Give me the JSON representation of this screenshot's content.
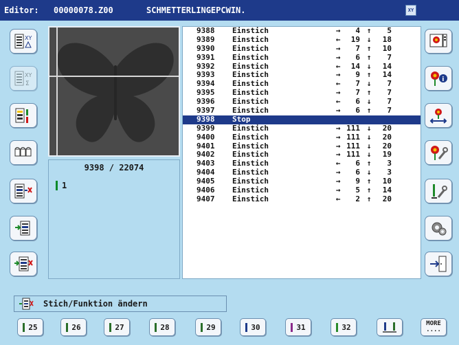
{
  "title": {
    "editor_label": "Editor:",
    "file_name": "00000078.Z00",
    "design_name": "SCHMETTERLINGEPCWIN."
  },
  "colors": {
    "titlebar": "#1e3a8a",
    "background": "#b4dcf0",
    "selection": "#1e3a8a",
    "needle_green": "#0a8a2a"
  },
  "left_toolbar": [
    "xy-delta-icon",
    "xy-sigma-icon",
    "color-change-icon",
    "chain-stitch-icon",
    "delete-stitch-icon",
    "insert-stitch-icon",
    "move-stitch-icon"
  ],
  "right_toolbar": [
    "design-view-icon",
    "flower-info-icon",
    "flower-move-icon",
    "flower-tool-icon",
    "needle-tool-icon",
    "gear-icon",
    "exit-door-icon"
  ],
  "stitch_counter": "9398 / 22074",
  "needle_indicator": "1",
  "stitches": [
    {
      "num": "9388",
      "fn": "Einstich",
      "dx_arrow": "→",
      "dx": "4",
      "dy_arrow": "↑",
      "dy": "5"
    },
    {
      "num": "9389",
      "fn": "Einstich",
      "dx_arrow": "←",
      "dx": "19",
      "dy_arrow": "↓",
      "dy": "18"
    },
    {
      "num": "9390",
      "fn": "Einstich",
      "dx_arrow": "→",
      "dx": "7",
      "dy_arrow": "↑",
      "dy": "10"
    },
    {
      "num": "9391",
      "fn": "Einstich",
      "dx_arrow": "→",
      "dx": "6",
      "dy_arrow": "↑",
      "dy": "7"
    },
    {
      "num": "9392",
      "fn": "Einstich",
      "dx_arrow": "←",
      "dx": "14",
      "dy_arrow": "↓",
      "dy": "14"
    },
    {
      "num": "9393",
      "fn": "Einstich",
      "dx_arrow": "→",
      "dx": "9",
      "dy_arrow": "↑",
      "dy": "14"
    },
    {
      "num": "9394",
      "fn": "Einstich",
      "dx_arrow": "←",
      "dx": "7",
      "dy_arrow": "↓",
      "dy": "7"
    },
    {
      "num": "9395",
      "fn": "Einstich",
      "dx_arrow": "→",
      "dx": "7",
      "dy_arrow": "↑",
      "dy": "7"
    },
    {
      "num": "9396",
      "fn": "Einstich",
      "dx_arrow": "←",
      "dx": "6",
      "dy_arrow": "↓",
      "dy": "7"
    },
    {
      "num": "9397",
      "fn": "Einstich",
      "dx_arrow": "→",
      "dx": "6",
      "dy_arrow": "↑",
      "dy": "7"
    },
    {
      "num": "9398",
      "fn": "Stop",
      "dx_arrow": "",
      "dx": "",
      "dy_arrow": "",
      "dy": "",
      "selected": true
    },
    {
      "num": "9399",
      "fn": "Einstich",
      "dx_arrow": "→",
      "dx": "111",
      "dy_arrow": "↓",
      "dy": "20"
    },
    {
      "num": "9400",
      "fn": "Einstich",
      "dx_arrow": "→",
      "dx": "111",
      "dy_arrow": "↓",
      "dy": "20"
    },
    {
      "num": "9401",
      "fn": "Einstich",
      "dx_arrow": "→",
      "dx": "111",
      "dy_arrow": "↓",
      "dy": "20"
    },
    {
      "num": "9402",
      "fn": "Einstich",
      "dx_arrow": "→",
      "dx": "111",
      "dy_arrow": "↓",
      "dy": "19"
    },
    {
      "num": "9403",
      "fn": "Einstich",
      "dx_arrow": "←",
      "dx": "6",
      "dy_arrow": "↑",
      "dy": "3"
    },
    {
      "num": "9404",
      "fn": "Einstich",
      "dx_arrow": "→",
      "dx": "6",
      "dy_arrow": "↓",
      "dy": "3"
    },
    {
      "num": "9405",
      "fn": "Einstich",
      "dx_arrow": "→",
      "dx": "9",
      "dy_arrow": "↑",
      "dy": "10"
    },
    {
      "num": "9406",
      "fn": "Einstich",
      "dx_arrow": "→",
      "dx": "5",
      "dy_arrow": "↑",
      "dy": "14"
    },
    {
      "num": "9407",
      "fn": "Einstich",
      "dx_arrow": "←",
      "dx": "2",
      "dy_arrow": "↑",
      "dy": "20"
    }
  ],
  "status_text": "Stich/Funktion ändern",
  "needle_buttons": [
    {
      "label": "25",
      "color": "#2a6e2a"
    },
    {
      "label": "26",
      "color": "#2a6e2a"
    },
    {
      "label": "27",
      "color": "#2a6e2a"
    },
    {
      "label": "28",
      "color": "#2a6e2a"
    },
    {
      "label": "29",
      "color": "#2a6e2a"
    },
    {
      "label": "30",
      "color": "#1e3a8a"
    },
    {
      "label": "31",
      "color": "#8a2a8a"
    },
    {
      "label": "32",
      "color": "#2a8a2a"
    }
  ],
  "more_button": {
    "label": "MORE",
    "dots": "...."
  }
}
